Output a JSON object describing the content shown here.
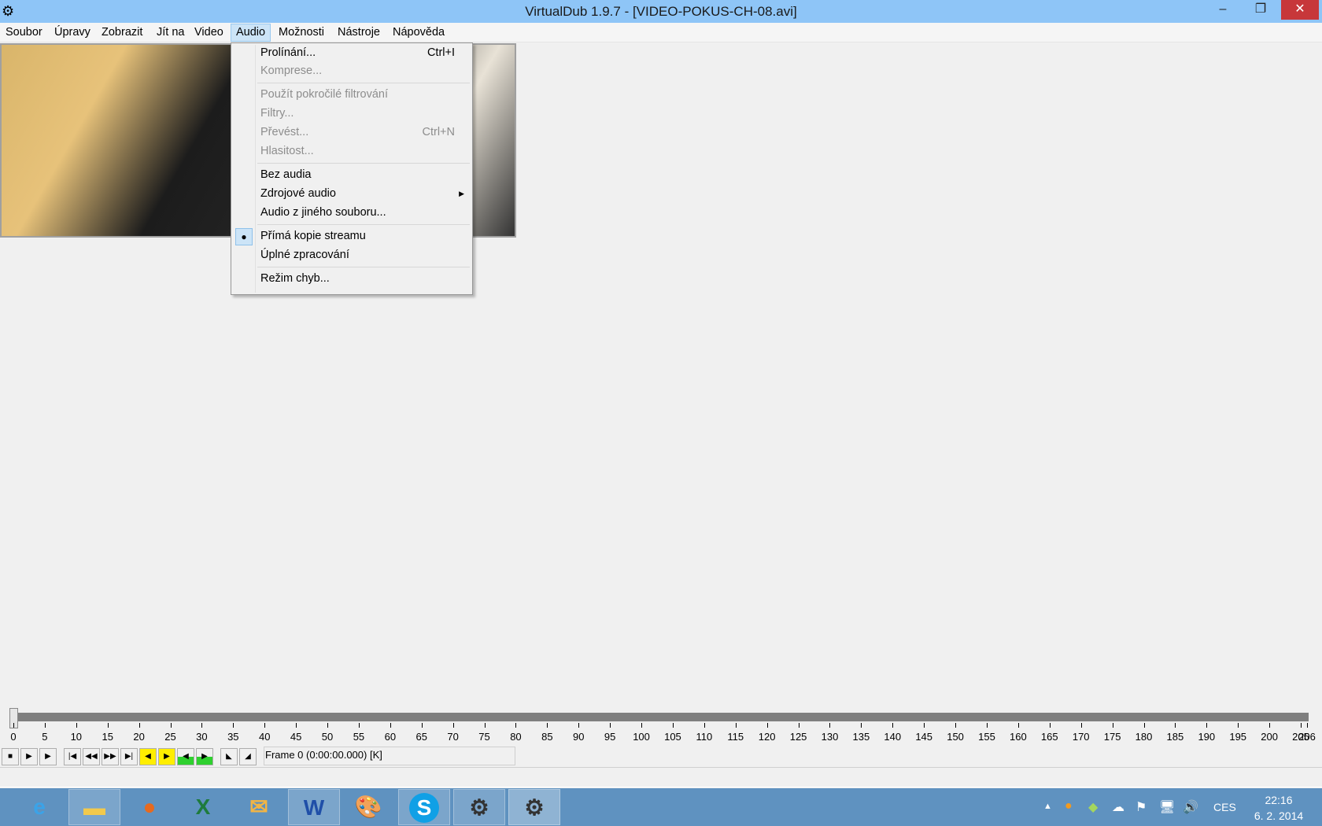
{
  "window": {
    "title": "VirtualDub 1.9.7 - [VIDEO-POKUS-CH-08.avi]",
    "minimize": "–",
    "restore": "❐",
    "close": "✕"
  },
  "menu": [
    "Soubor",
    "Úpravy",
    "Zobrazit",
    "Jít na",
    "Video",
    "Audio",
    "Možnosti",
    "Nástroje",
    "Nápověda"
  ],
  "audio_menu": {
    "items": [
      {
        "label": "Prolínání...",
        "shortcut": "Ctrl+I",
        "disabled": false
      },
      {
        "label": "Komprese...",
        "disabled": true
      },
      {
        "label": "Použít pokročilé filtrování",
        "disabled": true
      },
      {
        "label": "Filtry...",
        "disabled": true
      },
      {
        "label": "Převést...",
        "shortcut": "Ctrl+N",
        "disabled": true
      },
      {
        "label": "Hlasitost...",
        "disabled": true
      },
      {
        "label": "Bez audia"
      },
      {
        "label": "Zdrojové audio",
        "submenu": true
      },
      {
        "label": "Audio z jiného souboru..."
      },
      {
        "label": "Přímá kopie streamu",
        "checked": true
      },
      {
        "label": "Úplné zpracování"
      },
      {
        "label": "Režim chyb..."
      }
    ]
  },
  "timeline": {
    "min": 0,
    "max": 206,
    "step": 5,
    "position": 0
  },
  "frame_info": "Frame 0 (0:00:00.000) [K]",
  "taskbar": {
    "apps": [
      "Internet Explorer",
      "File Explorer",
      "Firefox",
      "Excel",
      "Windows Live Mail",
      "Word",
      "Paint",
      "Skype",
      "VirtualDub",
      "VirtualDub"
    ],
    "tray": {
      "language": "CES",
      "time": "22:16",
      "date": "6. 2. 2014"
    }
  }
}
